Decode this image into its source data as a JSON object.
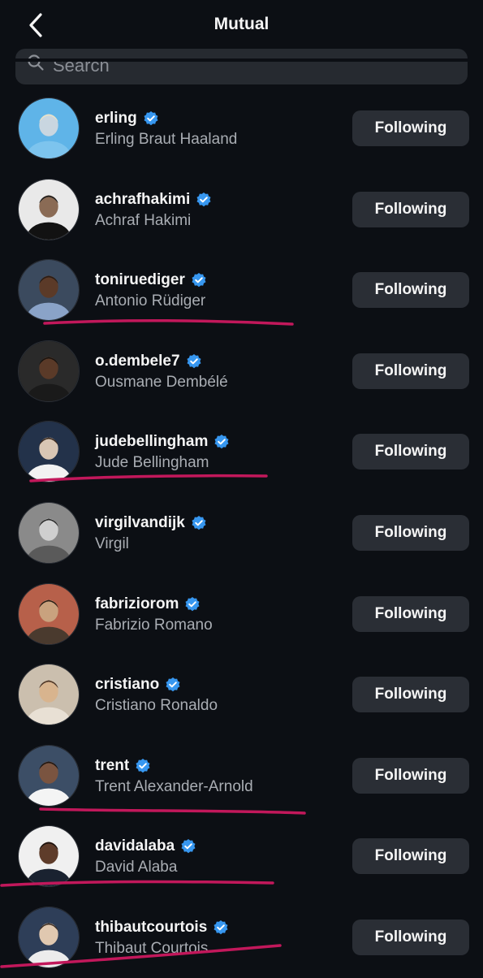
{
  "header": {
    "title": "Mutual",
    "back_icon": "chevron-left-icon"
  },
  "search": {
    "placeholder": "Search",
    "icon": "search-icon"
  },
  "colors": {
    "background": "#0c0f14",
    "button": "#2a2e35",
    "verified": "#3797f0",
    "annotation": "#c2185b"
  },
  "users": [
    {
      "username": "erling",
      "full_name": "Erling Braut Haaland",
      "button": "Following",
      "verified": true
    },
    {
      "username": "achrafhakimi",
      "full_name": "Achraf Hakimi",
      "button": "Following",
      "verified": true
    },
    {
      "username": "toniruediger",
      "full_name": "Antonio Rüdiger",
      "button": "Following",
      "verified": true,
      "underlined": true
    },
    {
      "username": "o.dembele7",
      "full_name": "Ousmane Dembélé",
      "button": "Following",
      "verified": true
    },
    {
      "username": "judebellingham",
      "full_name": "Jude Bellingham",
      "button": "Following",
      "verified": true,
      "underlined": true
    },
    {
      "username": "virgilvandijk",
      "full_name": "Virgil",
      "button": "Following",
      "verified": true
    },
    {
      "username": "fabriziorom",
      "full_name": "Fabrizio Romano",
      "button": "Following",
      "verified": true
    },
    {
      "username": "cristiano",
      "full_name": "Cristiano Ronaldo",
      "button": "Following",
      "verified": true
    },
    {
      "username": "trent",
      "full_name": "Trent Alexander-Arnold",
      "button": "Following",
      "verified": true,
      "underlined": true
    },
    {
      "username": "davidalaba",
      "full_name": "David Alaba",
      "button": "Following",
      "verified": true,
      "underlined": true
    },
    {
      "username": "thibautcourtois",
      "full_name": "Thibaut Courtois",
      "button": "Following",
      "verified": true,
      "underlined": true
    }
  ]
}
